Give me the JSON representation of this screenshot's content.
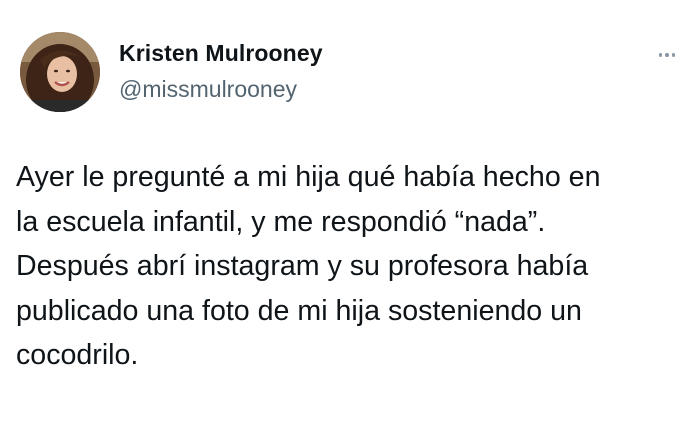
{
  "author": {
    "display_name": "Kristen Mulrooney",
    "handle": "@missmulrooney",
    "avatar_icon": "profile-photo"
  },
  "tweet": {
    "lines": [
      "Ayer le pregunté a mi hija qué había hecho en",
      "la escuela infantil, y me respondió “nada”.",
      "Después abrí instagram y su profesora había",
      "publicado una foto de mi hija sosteniendo un",
      "cocodrilo."
    ]
  },
  "menu": {
    "icon": "more-horizontal-icon"
  },
  "colors": {
    "text": "#0f1419",
    "secondary_text": "#536471",
    "icon": "#8b98a5",
    "background": "#ffffff"
  }
}
